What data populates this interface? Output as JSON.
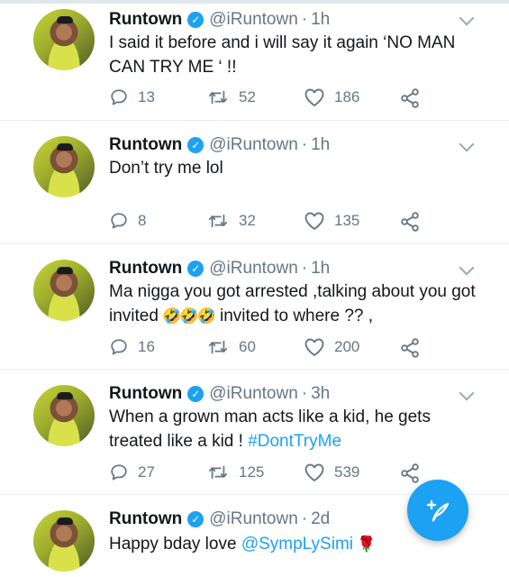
{
  "tweets": [
    {
      "name": "Runtown",
      "handle": "@iRuntown",
      "separator": "·",
      "time": "1h",
      "text": "I said it before and i will say it again ‘NO MAN CAN TRY ME ‘ !!",
      "replies": "13",
      "retweets": "52",
      "likes": "186"
    },
    {
      "name": "Runtown",
      "handle": "@iRuntown",
      "separator": "·",
      "time": "1h",
      "text": "Don’t try me lol",
      "replies": "8",
      "retweets": "32",
      "likes": "135"
    },
    {
      "name": "Runtown",
      "handle": "@iRuntown",
      "separator": "·",
      "time": "1h",
      "text_before": "Ma nigga you got arrested ,talking about you got invited ",
      "emojis": [
        "🤣",
        "🤣",
        "🤣"
      ],
      "text_after": " invited to where ?? ,",
      "replies": "16",
      "retweets": "60",
      "likes": "200"
    },
    {
      "name": "Runtown",
      "handle": "@iRuntown",
      "separator": "·",
      "time": "3h",
      "text": "When a grown man acts like a kid, he gets treated like a kid !",
      "hashtag": "#DontTryMe",
      "replies": "27",
      "retweets": "125",
      "likes": "539"
    },
    {
      "name": "Runtown",
      "handle": "@iRuntown",
      "separator": "·",
      "time": "2d",
      "text": "Happy bday love",
      "mention": "@SympLySimi",
      "emoji": "🌹"
    }
  ],
  "verified_badge": "✓",
  "icons": {
    "reply": "reply-icon",
    "retweet": "retweet-icon",
    "like": "heart-icon",
    "share": "share-icon",
    "compose": "compose-icon",
    "menu": "chevron-down-icon"
  },
  "colors": {
    "accent": "#1da1f2",
    "muted": "#657786",
    "text": "#14171a",
    "divider": "#e6ecf0"
  }
}
